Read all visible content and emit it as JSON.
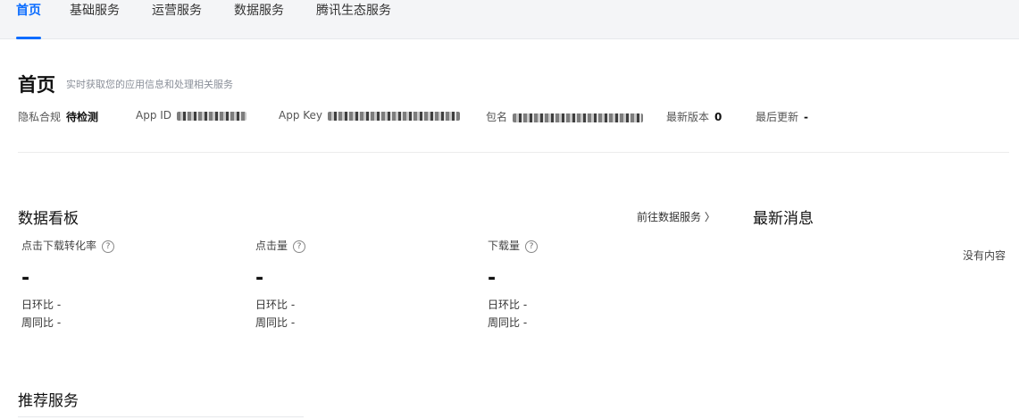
{
  "nav": {
    "tabs": [
      {
        "label": "首页"
      },
      {
        "label": "基础服务"
      },
      {
        "label": "运营服务"
      },
      {
        "label": "数据服务"
      },
      {
        "label": "腾讯生态服务"
      }
    ]
  },
  "header": {
    "title": "首页",
    "subtitle": "实时获取您的应用信息和处理相关服务"
  },
  "info": {
    "privacy_label": "隐私合规",
    "privacy_value": "待检测",
    "appid_label": "App ID",
    "appkey_label": "App Key",
    "package_label": "包名",
    "version_label": "最新版本",
    "version_value": "0",
    "updated_label": "最后更新",
    "updated_value": "-"
  },
  "dashboard": {
    "title": "数据看板",
    "link": "前往数据服务 〉",
    "metrics": [
      {
        "label": "点击下载转化率",
        "value": "-",
        "day_label": "日环比",
        "day_value": "-",
        "week_label": "周同比",
        "week_value": "-"
      },
      {
        "label": "点击量",
        "value": "-",
        "day_label": "日环比",
        "day_value": "-",
        "week_label": "周同比",
        "week_value": "-"
      },
      {
        "label": "下载量",
        "value": "-",
        "day_label": "日环比",
        "day_value": "-",
        "week_label": "周同比",
        "week_value": "-"
      }
    ],
    "help_glyph": "?"
  },
  "news": {
    "title": "最新消息",
    "empty": "没有内容"
  },
  "recommend": {
    "title": "推荐服务"
  }
}
